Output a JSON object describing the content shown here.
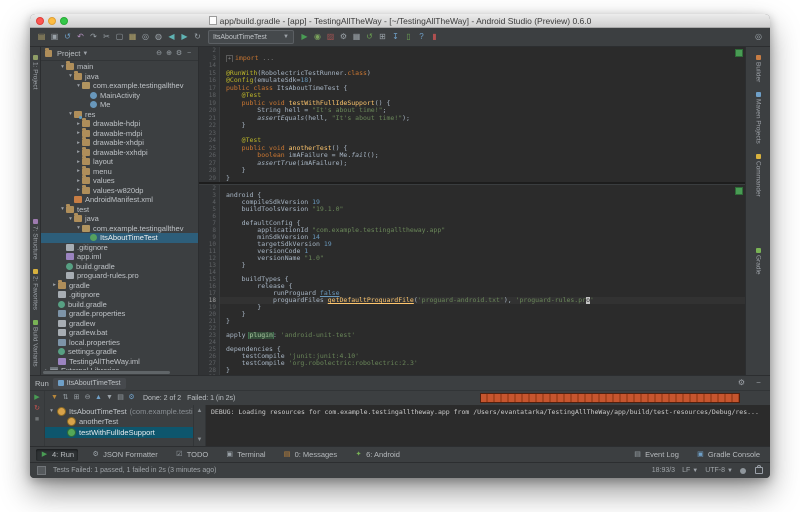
{
  "window": {
    "title": "app/build.gradle - [app] - TestingAllTheWay - [~/TestingAllTheWay] - Android Studio (Preview) 0.6.0"
  },
  "toolbar": {
    "run_config": "ItsAboutTimeTest",
    "left_icons": [
      "open",
      "save",
      "sync",
      "undo",
      "redo",
      "cut",
      "copy",
      "paste",
      "find",
      "replace",
      "back",
      "forward",
      "history"
    ],
    "right_icons": [
      "run",
      "debug",
      "coverage",
      "settings",
      "project-structure",
      "gradle-sync",
      "build",
      "sdk-manager",
      "avd-manager",
      "help",
      "monitor"
    ],
    "far_right_icon": "search-everywhere"
  },
  "left_stripe": {
    "top": [
      {
        "label": "1: Project",
        "color": "#8f9e66"
      }
    ],
    "bottom": [
      {
        "label": "7: Structure",
        "color": "#9e7bb0"
      },
      {
        "label": "2: Favorites",
        "color": "#d8b23e"
      },
      {
        "label": "Build Variants",
        "color": "#79b355"
      }
    ]
  },
  "right_stripe": {
    "items": [
      {
        "label": "Builder",
        "color": "#c77d44"
      },
      {
        "label": "Maven Projects",
        "color": "#6fa0c8"
      },
      {
        "label": "Commander",
        "color": "#d8b23e"
      },
      {
        "label": "Gradle",
        "color": "#79b355",
        "gap_before": true
      }
    ]
  },
  "project_panel": {
    "header": "Project",
    "header_icons": [
      "collapse-all",
      "locate",
      "settings",
      "hide"
    ],
    "tree": [
      {
        "label": "main",
        "indent": 2,
        "arrow": "v",
        "icon": "folder"
      },
      {
        "label": "java",
        "indent": 3,
        "arrow": "v",
        "icon": "folder"
      },
      {
        "label": "com.example.testingallthev",
        "indent": 4,
        "arrow": "v",
        "icon": "package"
      },
      {
        "label": "MainActivity",
        "indent": 5,
        "arrow": "",
        "icon": "class"
      },
      {
        "label": "Me",
        "indent": 5,
        "arrow": "",
        "icon": "class"
      },
      {
        "label": "res",
        "indent": 3,
        "arrow": "v",
        "icon": "folder-res"
      },
      {
        "label": "drawable-hdpi",
        "indent": 4,
        "arrow": ">",
        "icon": "folder"
      },
      {
        "label": "drawable-mdpi",
        "indent": 4,
        "arrow": ">",
        "icon": "folder"
      },
      {
        "label": "drawable-xhdpi",
        "indent": 4,
        "arrow": ">",
        "icon": "folder"
      },
      {
        "label": "drawable-xxhdpi",
        "indent": 4,
        "arrow": ">",
        "icon": "folder"
      },
      {
        "label": "layout",
        "indent": 4,
        "arrow": ">",
        "icon": "folder"
      },
      {
        "label": "menu",
        "indent": 4,
        "arrow": ">",
        "icon": "folder"
      },
      {
        "label": "values",
        "indent": 4,
        "arrow": ">",
        "icon": "folder"
      },
      {
        "label": "values-w820dp",
        "indent": 4,
        "arrow": ">",
        "icon": "folder"
      },
      {
        "label": "AndroidManifest.xml",
        "indent": 3,
        "arrow": "",
        "icon": "manifest"
      },
      {
        "label": "test",
        "indent": 2,
        "arrow": "v",
        "icon": "folder"
      },
      {
        "label": "java",
        "indent": 3,
        "arrow": "v",
        "icon": "folder"
      },
      {
        "label": "com.example.testingallthev",
        "indent": 4,
        "arrow": "v",
        "icon": "package"
      },
      {
        "label": "ItsAboutTimeTest",
        "indent": 5,
        "arrow": "",
        "icon": "test-class",
        "selected": true
      },
      {
        "label": ".gitignore",
        "indent": 2,
        "arrow": "",
        "icon": "file"
      },
      {
        "label": "app.iml",
        "indent": 2,
        "arrow": "",
        "icon": "iml"
      },
      {
        "label": "build.gradle",
        "indent": 2,
        "arrow": "",
        "icon": "gradle-file"
      },
      {
        "label": "proguard-rules.pro",
        "indent": 2,
        "arrow": "",
        "icon": "file"
      },
      {
        "label": "gradle",
        "indent": 1,
        "arrow": ">",
        "icon": "folder"
      },
      {
        "label": ".gitignore",
        "indent": 1,
        "arrow": "",
        "icon": "file"
      },
      {
        "label": "build.gradle",
        "indent": 1,
        "arrow": "",
        "icon": "gradle-file"
      },
      {
        "label": "gradle.properties",
        "indent": 1,
        "arrow": "",
        "icon": "properties"
      },
      {
        "label": "gradlew",
        "indent": 1,
        "arrow": "",
        "icon": "file"
      },
      {
        "label": "gradlew.bat",
        "indent": 1,
        "arrow": "",
        "icon": "file"
      },
      {
        "label": "local.properties",
        "indent": 1,
        "arrow": "",
        "icon": "properties"
      },
      {
        "label": "settings.gradle",
        "indent": 1,
        "arrow": "",
        "icon": "gradle-file"
      },
      {
        "label": "TestingAllTheWay.iml",
        "indent": 1,
        "arrow": "",
        "icon": "iml"
      },
      {
        "label": "External Libraries",
        "indent": 0,
        "arrow": ">",
        "icon": "library"
      }
    ]
  },
  "editor": {
    "panes": [
      {
        "lines": [
          {
            "n": "2",
            "s": []
          },
          {
            "n": "3",
            "s": [
              [
                "fm",
                "+"
              ],
              [
                "k",
                "import"
              ],
              [
                "g",
                " ..."
              ]
            ]
          },
          {
            "n": "14",
            "s": []
          },
          {
            "n": "15",
            "s": [
              [
                "a",
                "@RunWith"
              ],
              [
                "d",
                "(RobolectricTestRunner."
              ],
              [
                "k",
                "class"
              ],
              [
                "d",
                ")"
              ]
            ]
          },
          {
            "n": "16",
            "s": [
              [
                "a",
                "@Config"
              ],
              [
                "d",
                "(emulateSdk="
              ],
              [
                "n2",
                "18"
              ],
              [
                "d",
                ")"
              ]
            ]
          },
          {
            "n": "17",
            "s": [
              [
                "k",
                "public class"
              ],
              [
                "d",
                " ItsAboutTimeTest {"
              ]
            ]
          },
          {
            "n": "18",
            "s": [
              [
                "a",
                "    @Test"
              ]
            ]
          },
          {
            "n": "19",
            "s": [
              [
                "k",
                "    public void"
              ],
              [
                "m",
                " testWithFullIdeSupport"
              ],
              [
                "d",
                "() {"
              ]
            ]
          },
          {
            "n": "20",
            "s": [
              [
                "d",
                "        String hell = "
              ],
              [
                "s2",
                "\"It's about time!\""
              ],
              [
                "d",
                ";"
              ]
            ]
          },
          {
            "n": "21",
            "s": [
              [
                "i",
                "        assertEquals"
              ],
              [
                "d",
                "(hell, "
              ],
              [
                "s2",
                "\"It's about time!\""
              ],
              [
                "d",
                ");"
              ]
            ]
          },
          {
            "n": "22",
            "s": [
              [
                "d",
                "    }"
              ]
            ]
          },
          {
            "n": "23",
            "s": []
          },
          {
            "n": "24",
            "s": [
              [
                "a",
                "    @Test"
              ]
            ]
          },
          {
            "n": "25",
            "s": [
              [
                "k",
                "    public void"
              ],
              [
                "m",
                " anotherTest"
              ],
              [
                "d",
                "() {"
              ]
            ]
          },
          {
            "n": "26",
            "s": [
              [
                "k",
                "        boolean"
              ],
              [
                "d",
                " imAFailure = Me."
              ],
              [
                "i",
                "fail"
              ],
              [
                "d",
                "();"
              ]
            ]
          },
          {
            "n": "27",
            "s": [
              [
                "i",
                "        assertTrue"
              ],
              [
                "d",
                "(imAFailure);"
              ]
            ]
          },
          {
            "n": "28",
            "s": [
              [
                "d",
                "    }"
              ]
            ]
          },
          {
            "n": "29",
            "s": [
              [
                "d",
                "}"
              ]
            ]
          }
        ]
      },
      {
        "lines": [
          {
            "n": "2",
            "s": []
          },
          {
            "n": "3",
            "s": [
              [
                "d",
                "android {"
              ]
            ]
          },
          {
            "n": "4",
            "s": [
              [
                "d",
                "    compileSdkVersion "
              ],
              [
                "n2",
                "19"
              ]
            ]
          },
          {
            "n": "5",
            "s": [
              [
                "d",
                "    buildToolsVersion "
              ],
              [
                "s2",
                "\"19.1.0\""
              ]
            ]
          },
          {
            "n": "6",
            "s": []
          },
          {
            "n": "7",
            "s": [
              [
                "d",
                "    defaultConfig {"
              ]
            ]
          },
          {
            "n": "8",
            "s": [
              [
                "d",
                "        applicationId "
              ],
              [
                "s2",
                "\"com.example."
              ],
              [
                "sp",
                "testingalltheway"
              ],
              [
                "s2",
                ".app\""
              ]
            ]
          },
          {
            "n": "9",
            "s": [
              [
                "d",
                "        minSdkVersion "
              ],
              [
                "n2",
                "14"
              ]
            ]
          },
          {
            "n": "10",
            "s": [
              [
                "d",
                "        targetSdkVersion "
              ],
              [
                "n2",
                "19"
              ]
            ]
          },
          {
            "n": "11",
            "s": [
              [
                "d",
                "        versionCode "
              ],
              [
                "n2",
                "1"
              ]
            ]
          },
          {
            "n": "12",
            "s": [
              [
                "d",
                "        versionName "
              ],
              [
                "s2",
                "\"1.0\""
              ]
            ]
          },
          {
            "n": "13",
            "s": [
              [
                "d",
                "    }"
              ]
            ]
          },
          {
            "n": "14",
            "s": []
          },
          {
            "n": "15",
            "s": [
              [
                "d",
                "    buildTypes {"
              ]
            ]
          },
          {
            "n": "16",
            "s": [
              [
                "d",
                "        release {"
              ]
            ]
          },
          {
            "n": "17",
            "s": [
              [
                "d",
                "            runProguard "
              ],
              [
                "ln",
                "false"
              ]
            ]
          },
          {
            "n": "18",
            "cur": true,
            "s": [
              [
                "d",
                "            proguardFiles "
              ],
              [
                "mu",
                "getDefaultProguardFile"
              ],
              [
                "d",
                "("
              ],
              [
                "s2",
                "'proguard-android.txt'"
              ],
              [
                "d",
                "), "
              ],
              [
                "s2",
                "'proguard-rules.pr"
              ],
              [
                "cu",
                "o"
              ],
              [
                "s2",
                "'"
              ]
            ]
          },
          {
            "n": "19",
            "s": [
              [
                "d",
                "        }"
              ]
            ]
          },
          {
            "n": "20",
            "s": [
              [
                "d",
                "    }"
              ]
            ]
          },
          {
            "n": "21",
            "s": [
              [
                "d",
                "}"
              ]
            ]
          },
          {
            "n": "22",
            "s": []
          },
          {
            "n": "23",
            "s": [
              [
                "d",
                "apply "
              ],
              [
                "hl",
                "plugin"
              ],
              [
                "d",
                ": "
              ],
              [
                "s2",
                "'android-unit-test'"
              ]
            ]
          },
          {
            "n": "24",
            "s": []
          },
          {
            "n": "25",
            "s": [
              [
                "d",
                "dependencies {"
              ]
            ]
          },
          {
            "n": "26",
            "s": [
              [
                "d",
                "    testCompile "
              ],
              [
                "s2",
                "'junit:junit:4.10'"
              ]
            ]
          },
          {
            "n": "27",
            "s": [
              [
                "d",
                "    testCompile "
              ],
              [
                "s2",
                "'org."
              ],
              [
                "wr",
                "robolectric:robolectric"
              ],
              [
                "s2",
                ":2.3'"
              ]
            ]
          },
          {
            "n": "28",
            "s": [
              [
                "d",
                "}"
              ]
            ]
          },
          {
            "n": "29",
            "s": []
          }
        ]
      }
    ]
  },
  "run_panel": {
    "header": {
      "label": "Run",
      "tab": "ItsAboutTimeTest"
    },
    "left_icons": [
      "rerun",
      "rerun-failed",
      "stop"
    ],
    "top_icons": [
      "hide-passed",
      "sort",
      "expand-all",
      "collapse-all",
      "prev-failed",
      "next-failed",
      "export",
      "test-settings"
    ],
    "status": {
      "done": "Done: 2 of 2",
      "failed": "Failed: 1 (in 2s)"
    },
    "tests": [
      {
        "label": "ItsAboutTimeTest",
        "suffix": "(com.example.testin",
        "icon": "error",
        "arrow": "v",
        "indent": 0
      },
      {
        "label": "anotherTest",
        "icon": "failed",
        "indent": 1
      },
      {
        "label": "testWithFullIdeSupport",
        "icon": "passed",
        "indent": 1,
        "selected": true
      }
    ],
    "console": "DEBUG: Loading resources for com.example.testingalltheway.app from /Users/evantatarka/TestingAllTheWay/app/build/test-resources/Debug/res..."
  },
  "bottom_bar": {
    "left": [
      {
        "icon": "run-play",
        "label": "4: Run",
        "active": true
      },
      {
        "icon": "json-wrench",
        "label": "JSON Formatter"
      },
      {
        "icon": "todo",
        "label": "TODO"
      },
      {
        "icon": "terminal",
        "label": "Terminal"
      },
      {
        "icon": "messages",
        "label": "0: Messages"
      },
      {
        "icon": "android",
        "label": "6: Android"
      }
    ],
    "right": [
      {
        "icon": "event-log",
        "label": "Event Log"
      },
      {
        "icon": "gradle-console",
        "label": "Gradle Console"
      }
    ]
  },
  "status_bar": {
    "message": "Tests Failed: 1 passed, 1 failed in 2s (3 minutes ago)",
    "position": "18:93/3",
    "line_ending": "LF",
    "encoding": "UTF-8"
  },
  "colors": {
    "panel_bg": "#3c3f41",
    "editor_bg": "#2b2b2b",
    "tree_selection": "#2d5e7a",
    "test_selection": "#0e566d",
    "progress_red": "#c6552e",
    "ok_green": "#499c54"
  }
}
